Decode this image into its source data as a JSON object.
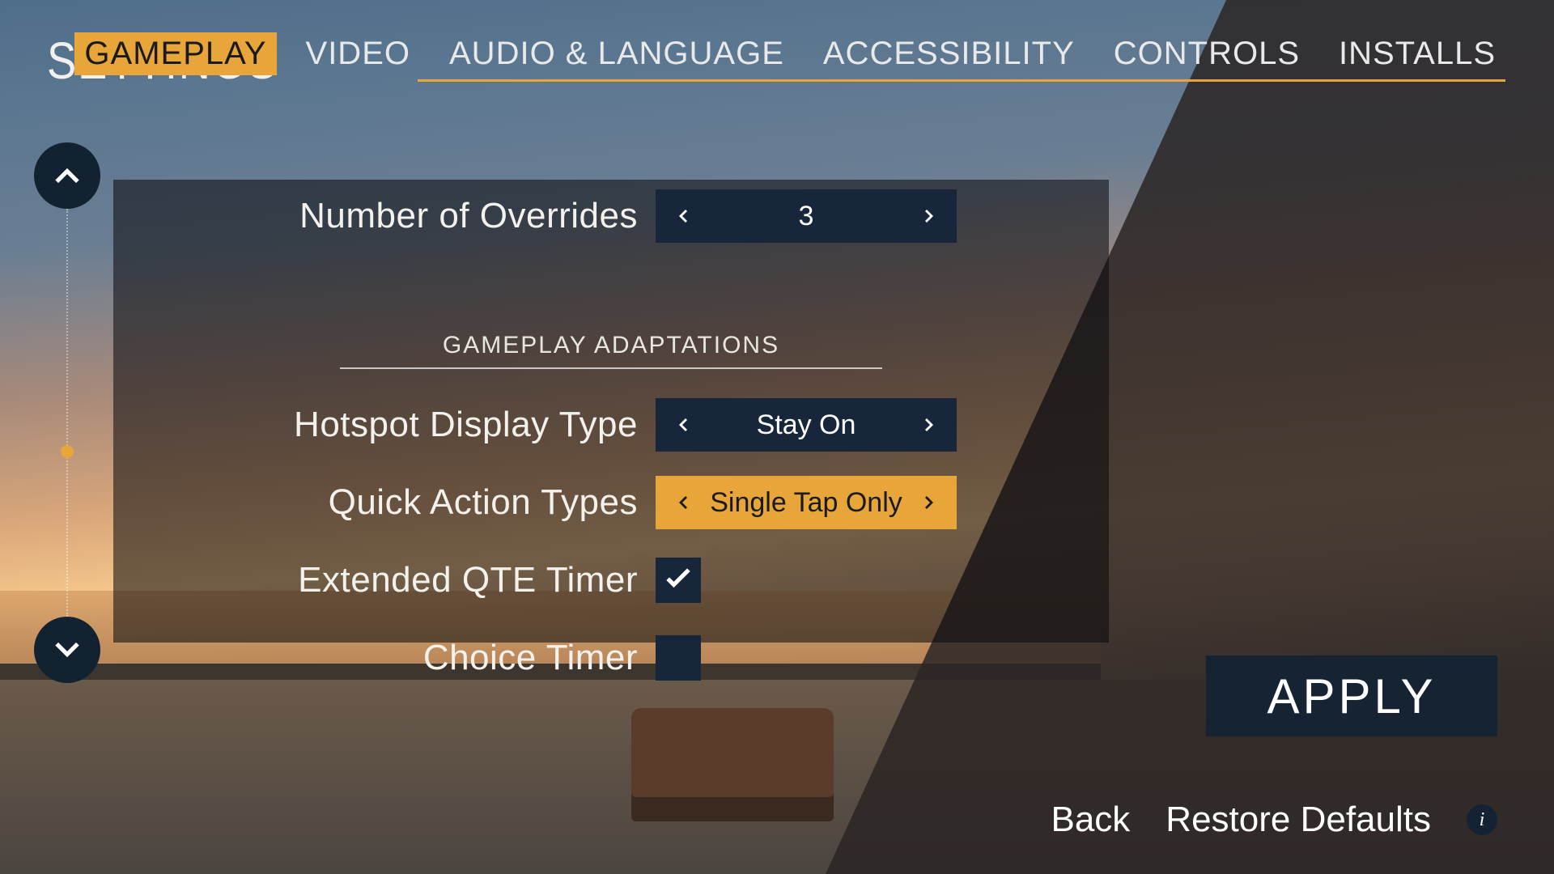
{
  "page_title": "SETTINGS",
  "tabs": {
    "gameplay": "GAMEPLAY",
    "video": "VIDEO",
    "audio": "AUDIO & LANGUAGE",
    "accessibility": "ACCESSIBILITY",
    "controls": "CONTROLS",
    "installs": "INSTALLS",
    "active": "gameplay"
  },
  "section_title": "GAMEPLAY ADAPTATIONS",
  "rows": {
    "overrides": {
      "label": "Number of Overrides",
      "value": "3"
    },
    "hotspot": {
      "label": "Hotspot Display Type",
      "value": "Stay On"
    },
    "quick": {
      "label": "Quick Action Types",
      "value": "Single Tap Only"
    },
    "qte": {
      "label": "Extended QTE Timer",
      "checked": true
    },
    "choice": {
      "label": "Choice Timer",
      "checked": false
    }
  },
  "buttons": {
    "apply": "APPLY",
    "back": "Back",
    "restore": "Restore Defaults"
  }
}
